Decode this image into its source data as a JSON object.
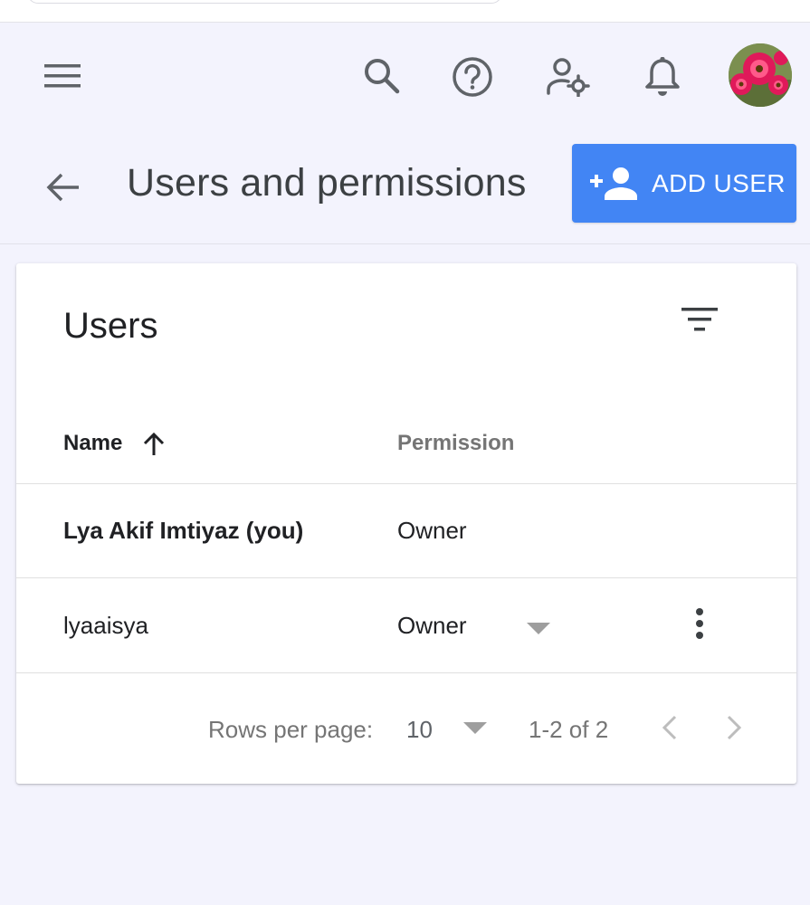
{
  "header": {
    "menu_icon": "menu-icon",
    "search_icon": "search-icon",
    "help_icon": "help-icon",
    "manage_accounts_icon": "manage-accounts-icon",
    "notifications_icon": "bell-icon",
    "avatar": "avatar"
  },
  "subheader": {
    "back_icon": "arrow-back-icon",
    "title": "Users and permissions",
    "add_user_label": "ADD USER"
  },
  "users_card": {
    "title": "Users",
    "columns": {
      "name": "Name",
      "permission": "Permission"
    },
    "sort": "ascending",
    "rows": [
      {
        "name": "Lya Akif Imtiyaz (you)",
        "permission": "Owner"
      },
      {
        "name": "lyaaisya",
        "permission": "Owner"
      }
    ],
    "pagination": {
      "rows_per_page_label": "Rows per page:",
      "rows_per_page_value": "10",
      "range": "1-2 of 2"
    }
  },
  "colors": {
    "accent": "#4285f4",
    "background": "#f3f3fd",
    "card": "#ffffff"
  }
}
